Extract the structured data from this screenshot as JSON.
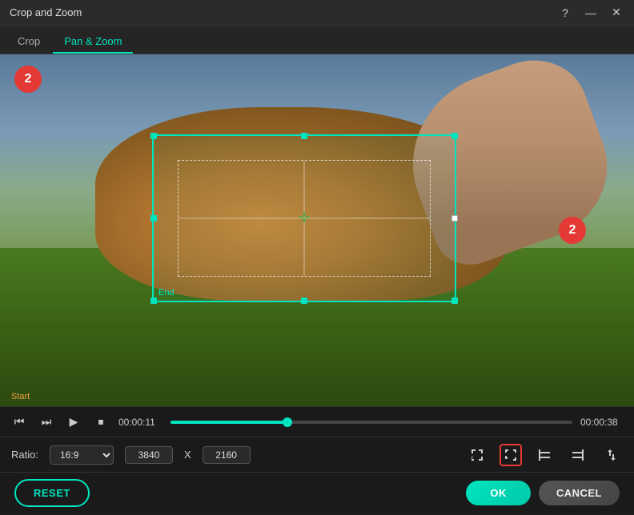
{
  "titleBar": {
    "title": "Crop and Zoom",
    "helpBtn": "?",
    "minBtn": "—",
    "closeBtn": "✕"
  },
  "tabs": [
    {
      "label": "Crop",
      "active": false
    },
    {
      "label": "Pan & Zoom",
      "active": true
    }
  ],
  "video": {
    "badge1": "2",
    "badge2": "2",
    "endLabel": "End",
    "startLabel": "Start"
  },
  "controls": {
    "timeStart": "00:00:11",
    "timeEnd": "00:00:38",
    "progressPercent": 29
  },
  "settings": {
    "ratioLabel": "Ratio:",
    "ratioValue": "16:9",
    "width": "3840",
    "height": "2160",
    "xLabel": "X"
  },
  "footer": {
    "resetLabel": "RESET",
    "okLabel": "OK",
    "cancelLabel": "CANCEL"
  }
}
